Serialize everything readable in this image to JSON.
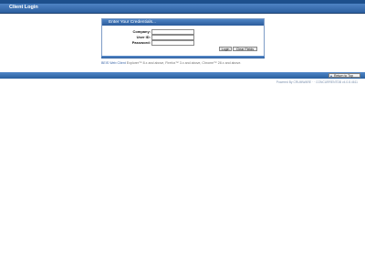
{
  "header": {
    "title": "Client Login"
  },
  "login": {
    "panel_title": "Enter Your Credentials...",
    "fields": [
      {
        "label": "Company:",
        "value": ""
      },
      {
        "label": "User ID:",
        "value": ""
      },
      {
        "label": "Password:",
        "value": ""
      }
    ],
    "buttons": {
      "login": "Login",
      "clear": "Clear Fields"
    }
  },
  "footer": {
    "note_prefix": "BEIS Web Client",
    "note_text": "Explorer™ 8.x and above, Firefox™ 3.x and above, Chrome™ 28.x and above.",
    "return_label": "Return to Top",
    "powered": "Powered By CRUMWARE · · CONCURRENTDB v4.0.8.4611"
  },
  "colors": {
    "bar": "#2c5f9f",
    "accent": "#3c66a8"
  },
  "icons": {
    "return": "up-arrow-icon"
  }
}
